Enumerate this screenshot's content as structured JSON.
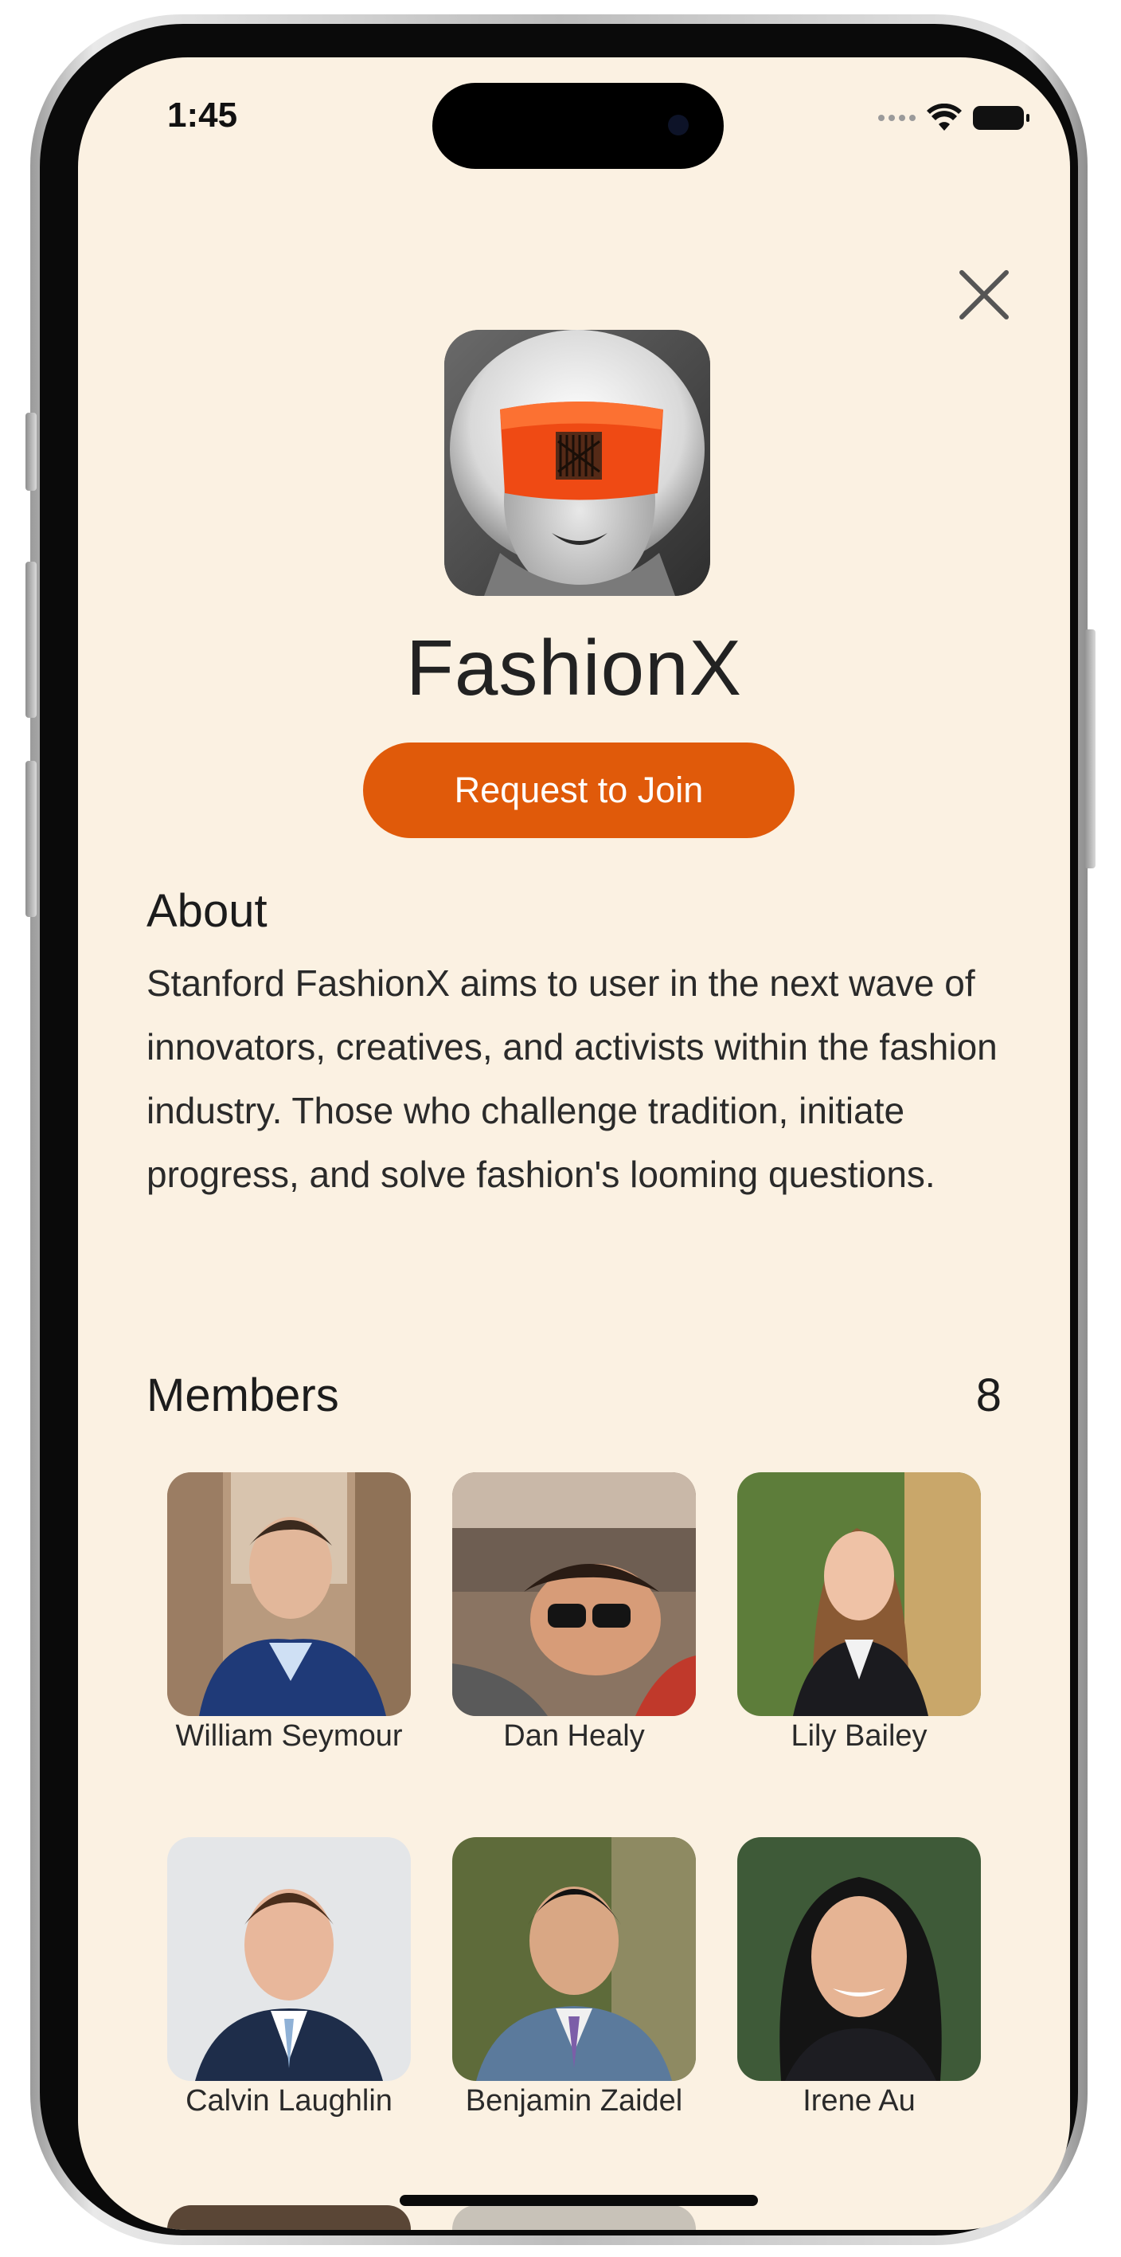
{
  "status_bar": {
    "time": "1:45",
    "icons": [
      "signal-dots-icon",
      "wifi-icon",
      "battery-icon"
    ]
  },
  "header": {
    "close_icon": "close-icon"
  },
  "group": {
    "name": "FashionX",
    "join_label": "Request to Join",
    "accent_color": "#e05a0a",
    "background_color": "#fbf1e2"
  },
  "about": {
    "title": "About",
    "text": "Stanford FashionX aims to user in the next wave of innovators, creatives, and activists within the fashion industry. Those who challenge tradition, initiate progress, and solve fashion's looming questions."
  },
  "members": {
    "title": "Members",
    "count": "8",
    "list": [
      {
        "name": "William Seymour"
      },
      {
        "name": "Dan Healy"
      },
      {
        "name": "Lily Bailey"
      },
      {
        "name": "Calvin Laughlin"
      },
      {
        "name": "Benjamin Zaidel"
      },
      {
        "name": "Irene Au"
      }
    ]
  }
}
